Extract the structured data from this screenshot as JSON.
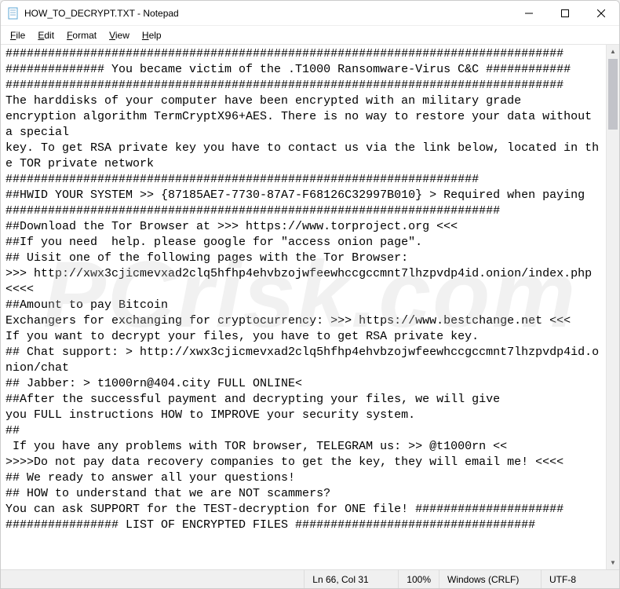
{
  "titlebar": {
    "title": "HOW_TO_DECRYPT.TXT - Notepad"
  },
  "menubar": {
    "items": [
      "File",
      "Edit",
      "Format",
      "View",
      "Help"
    ]
  },
  "content": {
    "line1": "###############################################################################",
    "line2": "############## You became victim of the .T1000 Ransomware-Virus C&C ############",
    "line3": "###############################################################################",
    "line4": "The harddisks of your computer have been encrypted with an military grade",
    "line5": "encryption algorithm TermCryptX96+AES. There is no way to restore your data without a special",
    "line6": "key. To get RSA private key you have to contact us via the link below, located in the TOR private network",
    "line7": "###################################################################",
    "line8": "##HWID YOUR SYSTEM >> {87185AE7-7730-87A7-F68126C32997B010} > Required when paying",
    "line9": "######################################################################",
    "line10": "##Download the Tor Browser at >>> https://www.torproject.org <<<",
    "line11": "##If you need  help. please google for \"access onion page\".",
    "line12": "## Uisit one of the following pages with the Tor Browser:",
    "line13": ">>> http://xwx3cjicmevxad2clq5hfhp4ehvbzojwfeewhccgccmnt7lhzpvdp4id.onion/index.php <<<<",
    "line14": "##Amount to pay Bitcoin",
    "line15": "Exchangers for exchanging for cryptocurrency: >>> https://www.bestchange.net <<<",
    "line16": "If you want to decrypt your files, you have to get RSA private key.",
    "line17": "## Chat support: > http://xwx3cjicmevxad2clq5hfhp4ehvbzojwfeewhccgccmnt7lhzpvdp4id.onion/chat",
    "line18": "## Jabber: > t1000rn@404.city FULL ONLINE<",
    "line19": "##After the successful payment and decrypting your files, we will give",
    "line20": "you FULL instructions HOW to IMPROVE your security system.",
    "line21": "##",
    "line22": " If you have any problems with TOR browser, TELEGRAM us: >> @t1000rn <<",
    "line23": ">>>>Do not pay data recovery companies to get the key, they will email me! <<<<",
    "line24": "## We ready to answer all your questions!",
    "line25": "## HOW to understand that we are NOT scammers?",
    "line26": "You can ask SUPPORT for the TEST-decryption for ONE file! #####################",
    "line27": "################ LIST OF ENCRYPTED FILES ##################################"
  },
  "statusbar": {
    "cursor": "Ln 66, Col 31",
    "zoom": "100%",
    "lineending": "Windows (CRLF)",
    "encoding": "UTF-8"
  },
  "watermark": "PCrisk.com"
}
